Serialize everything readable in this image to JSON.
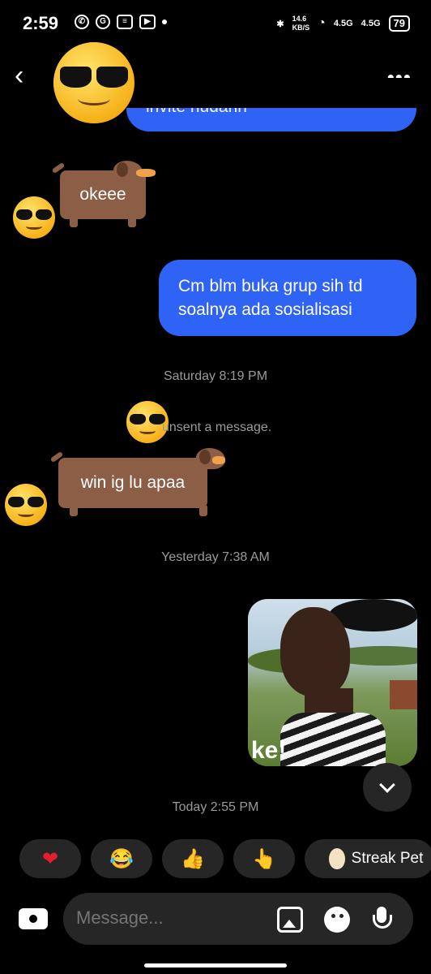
{
  "status_bar": {
    "time": "2:59",
    "net_speed": "14.6\nKB/S",
    "signal1": "4.5G",
    "signal2": "4.5G",
    "battery": "79"
  },
  "header": {
    "back_icon": "chevron-left-icon",
    "more_icon": "more-horizontal-icon"
  },
  "messages": {
    "partial_sent": "invite hudahh",
    "received_1": "okeee",
    "sent_1": "Cm blm buka grup sih td soalnya ada sosialisasi",
    "timestamp_1": "Saturday 8:19 PM",
    "unsent_text": "unsent a message.",
    "received_2": "win ig lu apaa",
    "timestamp_2": "Yesterday 7:38 AM",
    "photo_caption": "ke!",
    "timestamp_3": "Today 2:55 PM"
  },
  "reactions": [
    {
      "icon": "heart-icon",
      "glyph": "❤"
    },
    {
      "icon": "laughing-tears-icon",
      "glyph": "😂"
    },
    {
      "icon": "thumbs-up-icon",
      "glyph": "👍"
    },
    {
      "icon": "pointing-down-icon",
      "glyph": "👆"
    }
  ],
  "streak": {
    "label": "Streak Pet",
    "icon": "egg-icon"
  },
  "composer": {
    "placeholder": "Message...",
    "camera_icon": "camera-icon",
    "gallery_icon": "gallery-icon",
    "sticker_icon": "sticker-icon",
    "mic_icon": "mic-icon"
  },
  "colors": {
    "background": "#000000",
    "sent_bubble": "#2f63f5",
    "received_sticker": "#8b5e45",
    "chip_bg": "#262626",
    "meta_text": "#9a9a9a"
  }
}
